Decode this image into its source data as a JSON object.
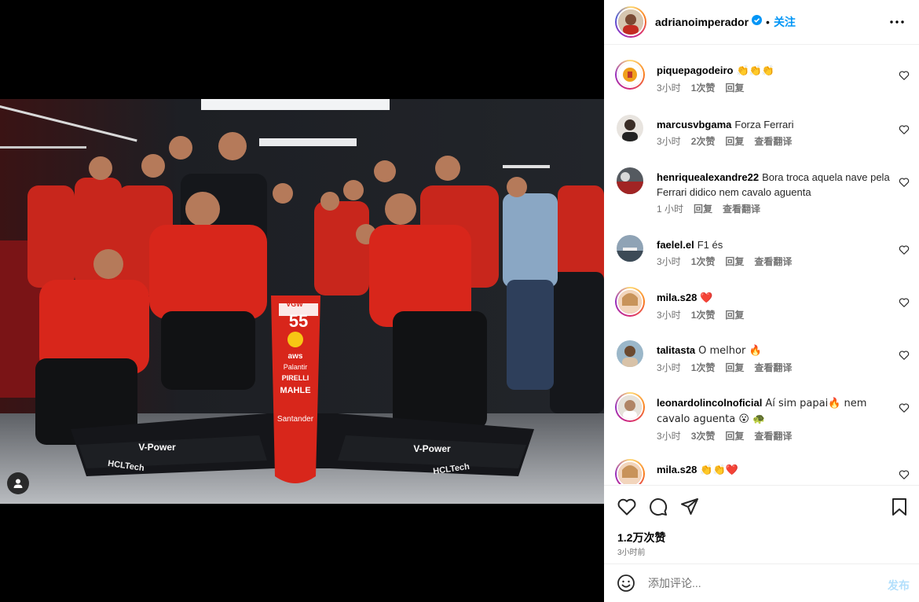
{
  "post": {
    "author": "adrianoimperador",
    "follow_label": "关注",
    "dot": "•",
    "more_icon": "more-horizontal-icon",
    "likes": "1.2万次赞",
    "time": "3小时前"
  },
  "comments": [
    {
      "user": "piquepagodeiro",
      "text": "👏👏👏",
      "time": "3小时",
      "likes": "1次赞",
      "reply": "回复",
      "translate": ""
    },
    {
      "user": "marcusvbgama",
      "text": "Forza Ferrari",
      "time": "3小时",
      "likes": "2次赞",
      "reply": "回复",
      "translate": "查看翻译"
    },
    {
      "user": "henriquealexandre22",
      "text": "Bora troca aquela nave pela Ferrari didico nem cavalo aguenta",
      "time": "1 小时",
      "likes": "",
      "reply": "回复",
      "translate": "查看翻译"
    },
    {
      "user": "faelel.el",
      "text": "F1 és",
      "time": "3小时",
      "likes": "1次赞",
      "reply": "回复",
      "translate": "查看翻译"
    },
    {
      "user": "mila.s28",
      "text": "❤️",
      "time": "3小时",
      "likes": "1次赞",
      "reply": "回复",
      "translate": ""
    },
    {
      "user": "talitasta",
      "text": "O melhor 🔥",
      "time": "3小时",
      "likes": "1次赞",
      "reply": "回复",
      "translate": "查看翻译"
    },
    {
      "user": "leonardolincolnoficial",
      "text": "Aí sim papai🔥 nem cavalo aguenta 😮 🐢",
      "time": "3小时",
      "likes": "3次赞",
      "reply": "回复",
      "translate": "查看翻译"
    },
    {
      "user": "mila.s28",
      "text": "👏👏❤️",
      "time": "",
      "likes": "",
      "reply": "",
      "translate": ""
    }
  ],
  "composer": {
    "placeholder": "添加评论...",
    "post_label": "发布"
  },
  "photo": {
    "car_number": "55",
    "sponsors": [
      "VGW",
      "aws",
      "Palantir",
      "PIRELLI",
      "MAHLE",
      "Santander",
      "V-Power",
      "HCLTech"
    ]
  },
  "colors": {
    "accent": "#0095f6",
    "ferrari_red": "#d8261b",
    "post_disabled": "#b2dffc"
  }
}
